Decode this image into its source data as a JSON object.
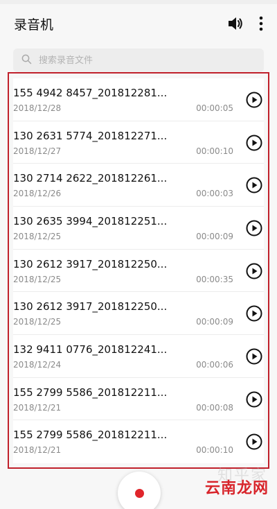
{
  "header": {
    "title": "录音机",
    "speaker_icon": "speaker-icon",
    "more_icon": "more-vertical-icon"
  },
  "search": {
    "placeholder": "搜索录音文件",
    "icon": "search-icon"
  },
  "recordings": [
    {
      "name": "155 4942 8457_201812281...",
      "date": "2018/12/28",
      "duration": "00:00:05"
    },
    {
      "name": "130 2631 5774_201812271...",
      "date": "2018/12/27",
      "duration": "00:00:10"
    },
    {
      "name": "130 2714 2622_201812261...",
      "date": "2018/12/26",
      "duration": "00:00:03"
    },
    {
      "name": "130 2635 3994_201812251...",
      "date": "2018/12/25",
      "duration": "00:00:09"
    },
    {
      "name": "130 2612 3917_201812250...",
      "date": "2018/12/25",
      "duration": "00:00:35"
    },
    {
      "name": "130 2612 3917_201812250...",
      "date": "2018/12/25",
      "duration": "00:00:09"
    },
    {
      "name": "132 9411 0776_201812241...",
      "date": "2018/12/24",
      "duration": "00:00:06"
    },
    {
      "name": "155 2799 5586_201812211...",
      "date": "2018/12/21",
      "duration": "00:00:08"
    },
    {
      "name": "155 2799 5586_201812211...",
      "date": "2018/12/21",
      "duration": "00:00:10"
    }
  ],
  "watermark": {
    "text": "云南龙网",
    "faint_text": "知乎家"
  },
  "colors": {
    "accent_red": "#e0252b",
    "highlight_border": "#c0202b",
    "secondary_text": "#8a8a8a"
  }
}
